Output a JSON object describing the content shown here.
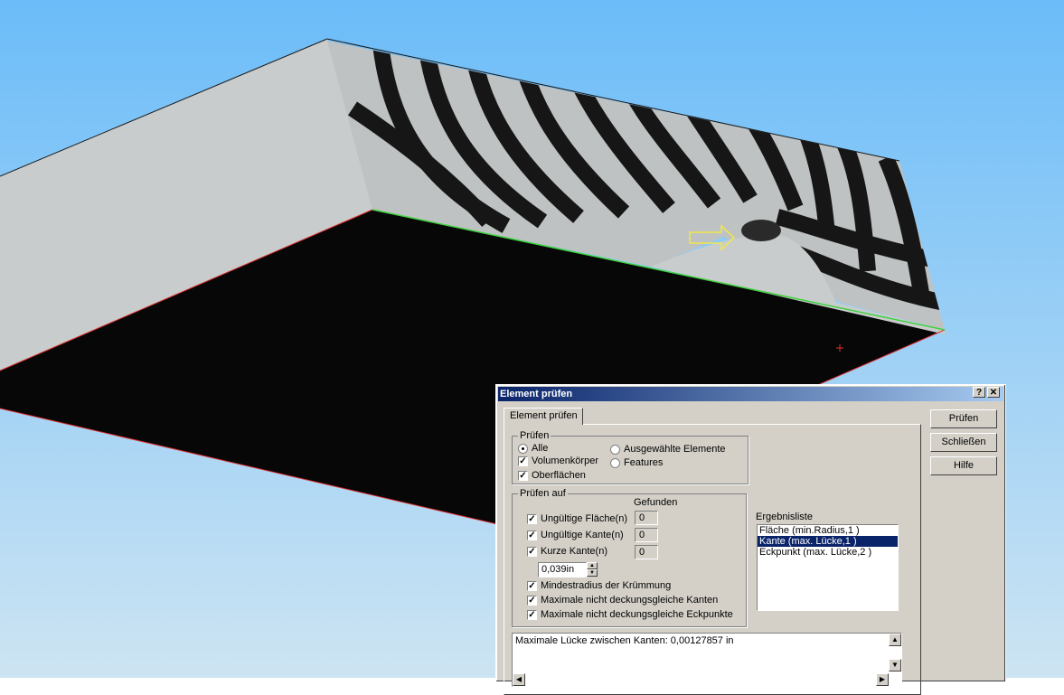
{
  "viewport": {
    "sky_top": "#6bbcf9",
    "sky_bottom": "#cde4f2",
    "face_light": "#c9cccc",
    "face_dark": "#070707",
    "edge_red": "#e03030",
    "edge_green": "#3fd13f",
    "arrow_color": "#f0e84a"
  },
  "dialog": {
    "title": "Element prüfen",
    "help_btn": "?",
    "close_btn": "✕",
    "tab_label": "Element prüfen",
    "buttons": {
      "check": "Prüfen",
      "close": "Schließen",
      "help": "Hilfe"
    },
    "check_group": {
      "legend": "Prüfen",
      "all": "Alle",
      "solids": "Volumenkörper",
      "surfaces": "Oberflächen",
      "selected": "Ausgewählte Elemente",
      "features": "Features"
    },
    "check_for_group": {
      "legend": "Prüfen auf",
      "found_header": "Gefunden",
      "invalid_faces": "Ungültige Fläche(n)",
      "invalid_faces_count": "0",
      "invalid_edges": "Ungültige Kante(n)",
      "invalid_edges_count": "0",
      "short_edges": "Kurze Kante(n)",
      "short_edges_count": "0",
      "short_edge_value": "0,039in",
      "min_radius": "Mindestradius der Krümmung",
      "max_gap_edges": "Maximale nicht deckungsgleiche Kanten",
      "max_gap_vertices": "Maximale nicht deckungsgleiche Eckpunkte"
    },
    "results": {
      "label": "Ergebnisliste",
      "items": [
        "Fläche (min.Radius,1  )",
        "Kante (max. Lücke,1  )",
        "Eckpunkt (max. Lücke,2  )"
      ],
      "selected_index": 1
    },
    "message": "Maximale Lücke zwischen Kanten: 0,00127857 in"
  }
}
